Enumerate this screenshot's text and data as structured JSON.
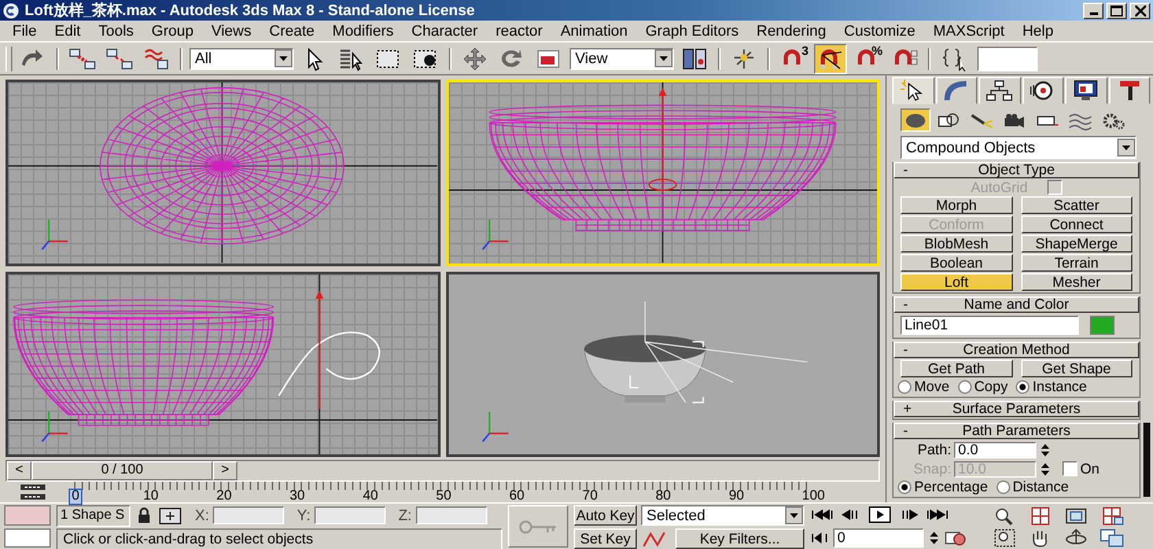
{
  "window": {
    "title": "Loft放样_茶杯.max - Autodesk 3ds Max 8  - Stand-alone License"
  },
  "menu": [
    "File",
    "Edit",
    "Tools",
    "Group",
    "Views",
    "Create",
    "Modifiers",
    "Character",
    "reactor",
    "Animation",
    "Graph Editors",
    "Rendering",
    "Customize",
    "MAXScript",
    "Help"
  ],
  "toolbar": [
    {
      "kind": "redo",
      "on": false
    },
    {
      "kind": "sep"
    },
    {
      "kind": "link",
      "on": false
    },
    {
      "kind": "unlink",
      "on": false
    },
    {
      "kind": "bind",
      "on": false
    },
    {
      "kind": "sep"
    },
    {
      "kind": "dropdown",
      "value": "All"
    },
    {
      "kind": "select",
      "on": false
    },
    {
      "kind": "select-by-name",
      "on": false
    },
    {
      "kind": "region",
      "on": false
    },
    {
      "kind": "crossing",
      "on": false
    },
    {
      "kind": "sep"
    },
    {
      "kind": "move",
      "on": false
    },
    {
      "kind": "rotate",
      "on": false
    },
    {
      "kind": "scale",
      "on": false
    },
    {
      "kind": "dropdown",
      "value": "View"
    },
    {
      "kind": "pivot",
      "on": false
    },
    {
      "kind": "sep"
    },
    {
      "kind": "manipulate",
      "on": false
    },
    {
      "kind": "sep"
    },
    {
      "kind": "snap",
      "on": false,
      "label": "3"
    },
    {
      "kind": "angle-snap",
      "on": true
    },
    {
      "kind": "percent-snap",
      "on": false,
      "label": "%"
    },
    {
      "kind": "spinner-snap",
      "on": false
    },
    {
      "kind": "sep"
    },
    {
      "kind": "named-edit",
      "on": false
    },
    {
      "kind": "field"
    }
  ],
  "viewports": [
    {
      "kind": "top",
      "active": false
    },
    {
      "kind": "front",
      "active": true
    },
    {
      "kind": "left",
      "active": false
    },
    {
      "kind": "perspective",
      "active": false
    }
  ],
  "time_slider": {
    "prev": "<",
    "thumb": "0 / 100",
    "next": ">",
    "level": 0
  },
  "track_bar": {
    "ticks": [
      {
        "label": "0",
        "selected": true
      },
      {
        "label": "10",
        "selected": false
      },
      {
        "label": "20",
        "selected": false
      },
      {
        "label": "30",
        "selected": false
      },
      {
        "label": "40",
        "selected": false
      },
      {
        "label": "50",
        "selected": false
      },
      {
        "label": "60",
        "selected": false
      },
      {
        "label": "70",
        "selected": false
      },
      {
        "label": "80",
        "selected": false
      },
      {
        "label": "90",
        "selected": false
      },
      {
        "label": "100",
        "selected": false
      }
    ]
  },
  "command_panel": {
    "tabs": [
      {
        "kind": "create",
        "selected": true
      },
      {
        "kind": "modify",
        "selected": false
      },
      {
        "kind": "hierarchy",
        "selected": false
      },
      {
        "kind": "motion",
        "selected": false
      },
      {
        "kind": "display",
        "selected": false
      },
      {
        "kind": "utilities",
        "selected": false
      }
    ],
    "categories": [
      {
        "kind": "geometry",
        "selected": true
      },
      {
        "kind": "shapes",
        "selected": false
      },
      {
        "kind": "lights",
        "selected": false
      },
      {
        "kind": "cameras",
        "selected": false
      },
      {
        "kind": "helpers",
        "selected": false
      },
      {
        "kind": "spacewarps",
        "selected": false
      },
      {
        "kind": "systems",
        "selected": false
      }
    ],
    "dropdown": "Compound Objects",
    "rollouts": [
      {
        "kind": "object-type",
        "sign": "-",
        "title": "Object Type",
        "autogrid": {
          "label": "AutoGrid",
          "checked": false,
          "disabled": true
        },
        "buttons": [
          {
            "label": "Morph",
            "selected": false,
            "disabled": false
          },
          {
            "label": "Scatter",
            "selected": false,
            "disabled": false
          },
          {
            "label": "Conform",
            "selected": false,
            "disabled": true
          },
          {
            "label": "Connect",
            "selected": false,
            "disabled": false
          },
          {
            "label": "BlobMesh",
            "selected": false,
            "disabled": false
          },
          {
            "label": "ShapeMerge",
            "selected": false,
            "disabled": false
          },
          {
            "label": "Boolean",
            "selected": false,
            "disabled": false
          },
          {
            "label": "Terrain",
            "selected": false,
            "disabled": false
          },
          {
            "label": "Loft",
            "selected": true,
            "disabled": false
          },
          {
            "label": "Mesher",
            "selected": false,
            "disabled": false
          }
        ]
      },
      {
        "kind": "name-color",
        "sign": "-",
        "title": "Name and Color",
        "name": "Line01",
        "color": "#22aa22"
      },
      {
        "kind": "creation-method",
        "sign": "-",
        "title": "Creation Method",
        "buttons": [
          "Get Path",
          "Get Shape"
        ],
        "radios": [
          {
            "label": "Move",
            "selected": false
          },
          {
            "label": "Copy",
            "selected": false
          },
          {
            "label": "Instance",
            "selected": true
          }
        ]
      },
      {
        "kind": "collapsed",
        "sign": "+",
        "title": "Surface Parameters"
      },
      {
        "kind": "path-params",
        "sign": "-",
        "title": "Path Parameters",
        "path": {
          "label": "Path:",
          "value": "0.0",
          "disabled": false
        },
        "snap": {
          "label": "Snap:",
          "value": "10.0",
          "disabled": true
        },
        "on": {
          "label": "On",
          "checked": false
        },
        "radios": [
          {
            "label": "Percentage",
            "selected": true
          },
          {
            "label": "Distance",
            "selected": false
          }
        ]
      }
    ]
  },
  "status": {
    "selection": "1 Shape S",
    "coords": [
      "X:",
      "Y:",
      "Z:"
    ],
    "prompt": "Click or click-and-drag to select objects",
    "auto_key": "Auto Key",
    "set_key": "Set Key",
    "key_mode": "Selected",
    "key_filters": "Key Filters...",
    "frame": "0"
  }
}
